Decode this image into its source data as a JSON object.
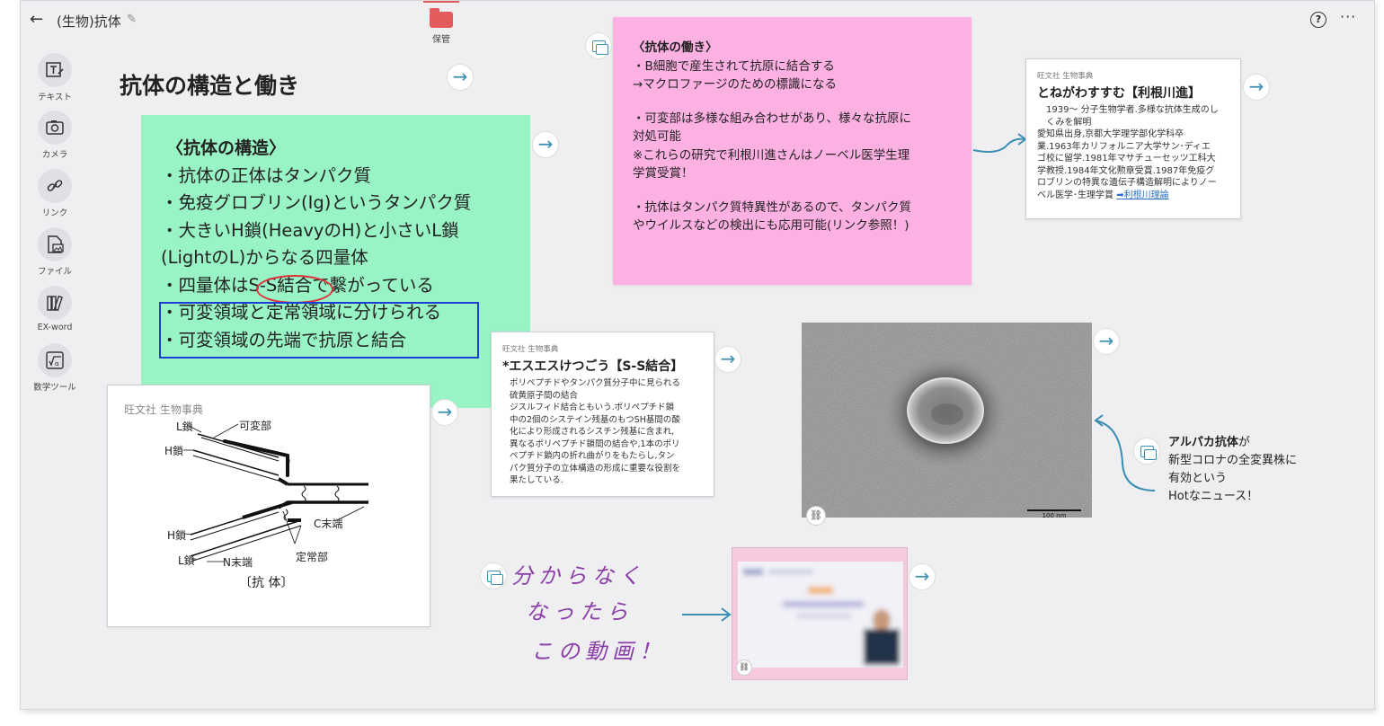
{
  "topbar": {
    "title": "(生物)抗体",
    "storage_label": "保管"
  },
  "tools": [
    {
      "label": "テキスト",
      "icon": "text-icon"
    },
    {
      "label": "カメラ",
      "icon": "camera-icon"
    },
    {
      "label": "リンク",
      "icon": "link-icon"
    },
    {
      "label": "ファイル",
      "icon": "file-icon"
    },
    {
      "label": "EX-word",
      "icon": "ex-word-icon"
    },
    {
      "label": "数学ツール",
      "icon": "math-tool-icon"
    }
  ],
  "heading": "抗体の構造と働き",
  "green_note": {
    "lines": [
      "〈抗体の構造〉",
      "・抗体の正体はタンパク質",
      "・免疫グロブリン(Ig)というタンパク質",
      "・大きいH鎖(HeavyのH)と小さいL鎖",
      "(LightのL)からなる四量体",
      "・四量体はS-S結合で繋がっている",
      "・可変領域と定常領域に分けられる",
      "・可変領域の先端で抗原と結合"
    ]
  },
  "diagram": {
    "publisher": "旺文社 生物事典",
    "labels": {
      "l_chain_top": "L鎖",
      "variable": "可変部",
      "h_chain_top": "H鎖",
      "h_chain_bottom": "H鎖",
      "c_terminal": "C末端",
      "l_chain_bottom": "L鎖",
      "n_terminal": "N末端",
      "constant": "定常部",
      "caption": "〔抗 体〕"
    }
  },
  "pink_note": {
    "paragraphs": [
      [
        "〈抗体の働き〉",
        "・B細胞で産生されて抗原に結合する",
        "→マクロファージのための標識になる"
      ],
      [
        "・可変部は多様な組み合わせがあり、様々な抗原に",
        "対処可能",
        "※これらの研究で利根川進さんはノーベル医学生理",
        "学賞受賞！"
      ],
      [
        "・抗体はタンパク質特異性があるので、タンパク質",
        "やウイルスなどの検出にも応用可能(リンク参照！)"
      ]
    ]
  },
  "dict1": {
    "publisher": "旺文社 生物事典",
    "word": "とねがわすすむ【利根川進】",
    "body_lines": [
      "1939〜 分子生物学者.多様な抗体生成のし",
      "くみを解明",
      "愛知県出身,京都大学理学部化学科卒",
      "業.1963年カリフォルニア大学サン･ディエ",
      "ゴ校に留学.1981年マサチューセッツ工科大",
      "学教授.1984年文化勲章受賞.1987年免疫グ",
      "ロブリンの特異な遺伝子構造解明によりノー",
      "ベル医学･生理学賞"
    ],
    "link_text": "➡利根川理論"
  },
  "dict2": {
    "publisher": "旺文社 生物事典",
    "word": "*エスエスけつごう【S-S結合】",
    "body_lines": [
      "ポリペプチドやタンパク質分子中に見られる",
      "硫黄原子間の結合",
      "ジスルフィド結合ともいう.ポリペプチド鎖",
      "中の2個のシステイン残基のもつSH基間の酸",
      "化により形成されるシスチン残基に含まれ,",
      "異なるポリペプチド鎖間の結合や,1本のポリ",
      "ペプチド鎖内の折れ曲がりをもたらし,タン",
      "パク質分子の立体構造の形成に重要な役割を",
      "果たしている."
    ]
  },
  "photo": {
    "scale_label": "100 nm"
  },
  "alpaca_note": {
    "bold": "アルパカ抗体",
    "lines": [
      "が",
      "新型コロナの全変異株に",
      "有効という",
      "Hotなニュース！"
    ]
  },
  "handwriting": {
    "lines": [
      "分からなく",
      "なったら",
      "この動画！"
    ]
  },
  "colors": {
    "green_note": "#98f3c5",
    "pink_note": "#fdb0e2",
    "arrow": "#3a8fb3",
    "circle_mark": "#e0303a",
    "box_mark": "#1b3fd6",
    "handwriting": "#8b3fa8",
    "storage_folder": "#e25c5c"
  }
}
